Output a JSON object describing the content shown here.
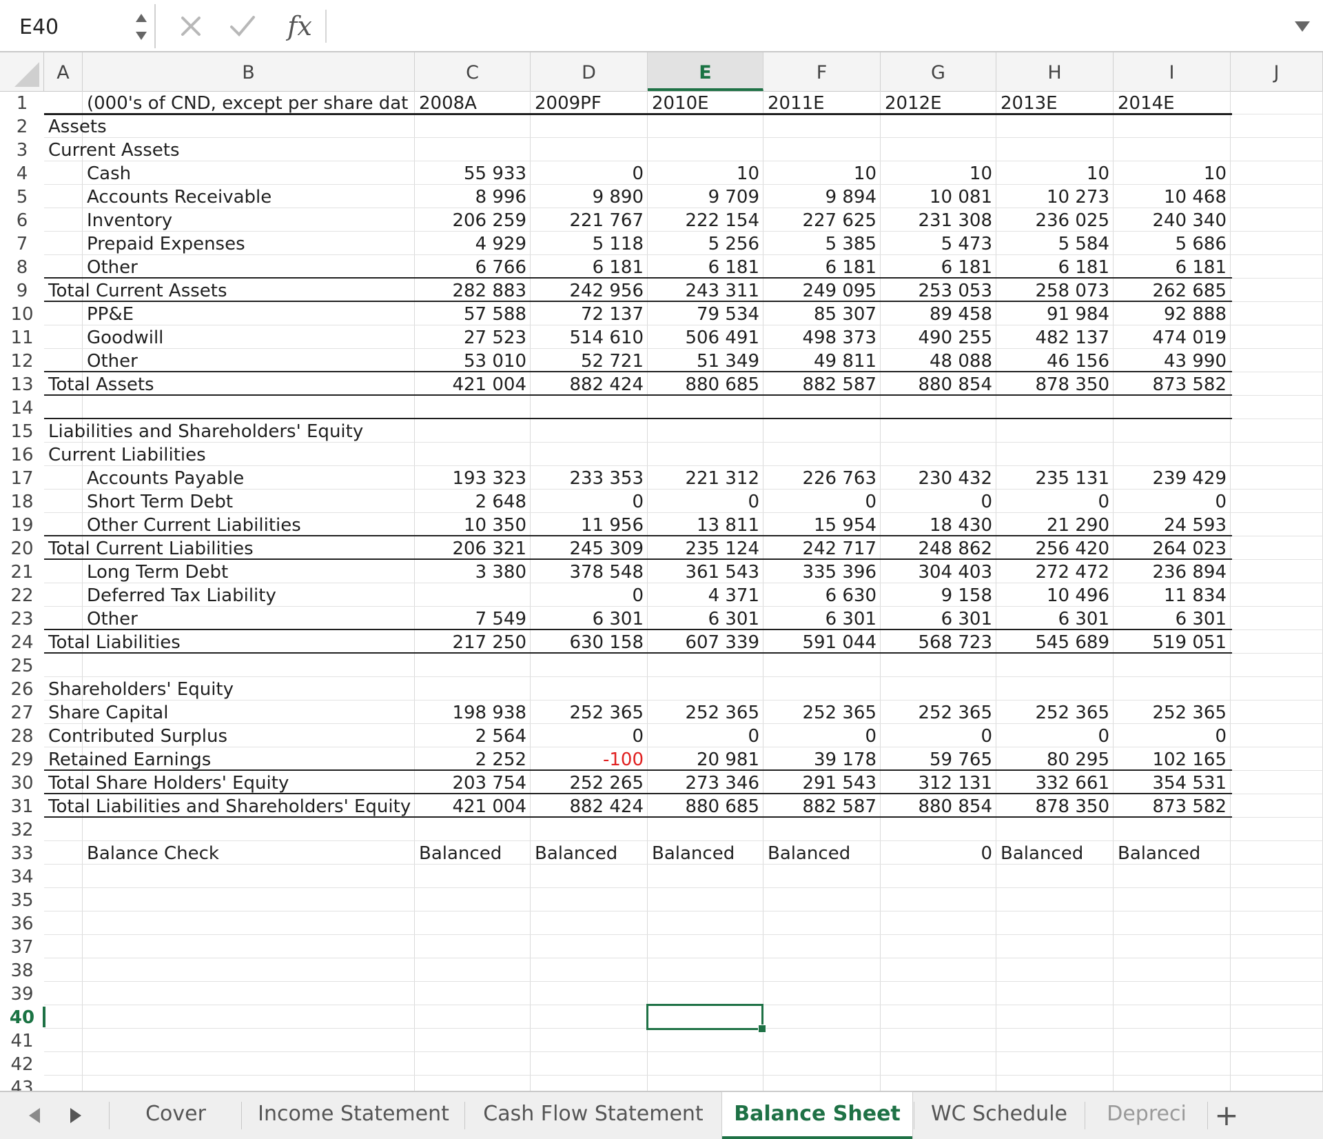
{
  "formula_bar": {
    "name_box": "E40",
    "fx_label": "fx",
    "formula": ""
  },
  "columns": [
    "A",
    "B",
    "C",
    "D",
    "E",
    "F",
    "G",
    "H",
    "I",
    "J"
  ],
  "active_column": "E",
  "active_row": "40",
  "rows": [
    {
      "n": "1",
      "b": "(000's of CND, except per share dat",
      "c": "2008A",
      "d": "2009PF",
      "e": "2010E",
      "f": "2011E",
      "g": "2012E",
      "h": "2013E",
      "i": "2014E"
    },
    {
      "n": "2",
      "a": "Assets"
    },
    {
      "n": "3",
      "a": "Current Assets"
    },
    {
      "n": "4",
      "b": "Cash",
      "c": "55 933",
      "d": "0",
      "e": "10",
      "f": "10",
      "g": "10",
      "h": "10",
      "i": "10"
    },
    {
      "n": "5",
      "b": "Accounts Receivable",
      "c": "8 996",
      "d": "9 890",
      "e": "9 709",
      "f": "9 894",
      "g": "10 081",
      "h": "10 273",
      "i": "10 468"
    },
    {
      "n": "6",
      "b": "Inventory",
      "c": "206 259",
      "d": "221 767",
      "e": "222 154",
      "f": "227 625",
      "g": "231 308",
      "h": "236 025",
      "i": "240 340"
    },
    {
      "n": "7",
      "b": "Prepaid Expenses",
      "c": "4 929",
      "d": "5 118",
      "e": "5 256",
      "f": "5 385",
      "g": "5 473",
      "h": "5 584",
      "i": "5 686"
    },
    {
      "n": "8",
      "b": "Other",
      "c": "6 766",
      "d": "6 181",
      "e": "6 181",
      "f": "6 181",
      "g": "6 181",
      "h": "6 181",
      "i": "6 181"
    },
    {
      "n": "9",
      "a": "Total Current Assets",
      "c": "282 883",
      "d": "242 956",
      "e": "243 311",
      "f": "249 095",
      "g": "253 053",
      "h": "258 073",
      "i": "262 685"
    },
    {
      "n": "10",
      "b": "PP&E",
      "c": "57 588",
      "d": "72 137",
      "e": "79 534",
      "f": "85 307",
      "g": "89 458",
      "h": "91 984",
      "i": "92 888"
    },
    {
      "n": "11",
      "b": "Goodwill",
      "c": "27 523",
      "d": "514 610",
      "e": "506 491",
      "f": "498 373",
      "g": "490 255",
      "h": "482 137",
      "i": "474 019"
    },
    {
      "n": "12",
      "b": "Other",
      "c": "53 010",
      "d": "52 721",
      "e": "51 349",
      "f": "49 811",
      "g": "48 088",
      "h": "46 156",
      "i": "43 990"
    },
    {
      "n": "13",
      "a": "Total Assets",
      "c": "421 004",
      "d": "882 424",
      "e": "880 685",
      "f": "882 587",
      "g": "880 854",
      "h": "878 350",
      "i": "873 582"
    },
    {
      "n": "14"
    },
    {
      "n": "15",
      "a": "Liabilities and Shareholders' Equity"
    },
    {
      "n": "16",
      "a": "Current Liabilities"
    },
    {
      "n": "17",
      "b": "Accounts Payable",
      "c": "193 323",
      "d": "233 353",
      "e": "221 312",
      "f": "226 763",
      "g": "230 432",
      "h": "235 131",
      "i": "239 429"
    },
    {
      "n": "18",
      "b": "Short Term Debt",
      "c": "2 648",
      "d": "0",
      "e": "0",
      "f": "0",
      "g": "0",
      "h": "0",
      "i": "0"
    },
    {
      "n": "19",
      "b": "Other Current Liabilities",
      "c": "10 350",
      "d": "11 956",
      "e": "13 811",
      "f": "15 954",
      "g": "18 430",
      "h": "21 290",
      "i": "24 593"
    },
    {
      "n": "20",
      "a": "Total Current Liabilities",
      "c": "206 321",
      "d": "245 309",
      "e": "235 124",
      "f": "242 717",
      "g": "248 862",
      "h": "256 420",
      "i": "264 023"
    },
    {
      "n": "21",
      "b": "Long Term Debt",
      "c": "3 380",
      "d": "378 548",
      "e": "361 543",
      "f": "335 396",
      "g": "304 403",
      "h": "272 472",
      "i": "236 894"
    },
    {
      "n": "22",
      "b": "Deferred Tax Liability",
      "d": "0",
      "e": "4 371",
      "f": "6 630",
      "g": "9 158",
      "h": "10 496",
      "i": "11 834"
    },
    {
      "n": "23",
      "b": "Other",
      "c": "7 549",
      "d": "6 301",
      "e": "6 301",
      "f": "6 301",
      "g": "6 301",
      "h": "6 301",
      "i": "6 301"
    },
    {
      "n": "24",
      "a": "Total Liabilities",
      "c": "217 250",
      "d": "630 158",
      "e": "607 339",
      "f": "591 044",
      "g": "568 723",
      "h": "545 689",
      "i": "519 051"
    },
    {
      "n": "25"
    },
    {
      "n": "26",
      "a": "Shareholders' Equity"
    },
    {
      "n": "27",
      "a": "Share Capital",
      "c": "198 938",
      "d": "252 365",
      "e": "252 365",
      "f": "252 365",
      "g": "252 365",
      "h": "252 365",
      "i": "252 365"
    },
    {
      "n": "28",
      "a": "Contributed Surplus",
      "c": "2 564",
      "d": "0",
      "e": "0",
      "f": "0",
      "g": "0",
      "h": "0",
      "i": "0"
    },
    {
      "n": "29",
      "a": "Retained Earnings",
      "c": "2 252",
      "d": "-100",
      "e": "20 981",
      "f": "39 178",
      "g": "59 765",
      "h": "80 295",
      "i": "102 165"
    },
    {
      "n": "30",
      "a": "Total Share Holders' Equity",
      "c": "203 754",
      "d": "252 265",
      "e": "273 346",
      "f": "291 543",
      "g": "312 131",
      "h": "332 661",
      "i": "354 531"
    },
    {
      "n": "31",
      "a": "Total Liabilities and Shareholders' Equity",
      "c": "421 004",
      "d": "882 424",
      "e": "880 685",
      "f": "882 587",
      "g": "880 854",
      "h": "878 350",
      "i": "873 582"
    },
    {
      "n": "32"
    },
    {
      "n": "33",
      "b": "Balance Check",
      "c": "Balanced",
      "d": "Balanced",
      "e": "Balanced",
      "f": "Balanced",
      "g": "0",
      "h": "Balanced",
      "i": "Balanced"
    },
    {
      "n": "34"
    },
    {
      "n": "35"
    },
    {
      "n": "36"
    },
    {
      "n": "37"
    },
    {
      "n": "38"
    },
    {
      "n": "39"
    },
    {
      "n": "40"
    },
    {
      "n": "41"
    },
    {
      "n": "42"
    },
    {
      "n": "43"
    }
  ],
  "tabs": [
    "Cover",
    "Income Statement",
    "Cash Flow Statement",
    "Balance Sheet",
    "WC Schedule",
    "Depreci"
  ],
  "active_tab": "Balance Sheet",
  "add_sheet_label": "+",
  "colors": {
    "accent": "#1e7145",
    "negative": "#e02020"
  }
}
